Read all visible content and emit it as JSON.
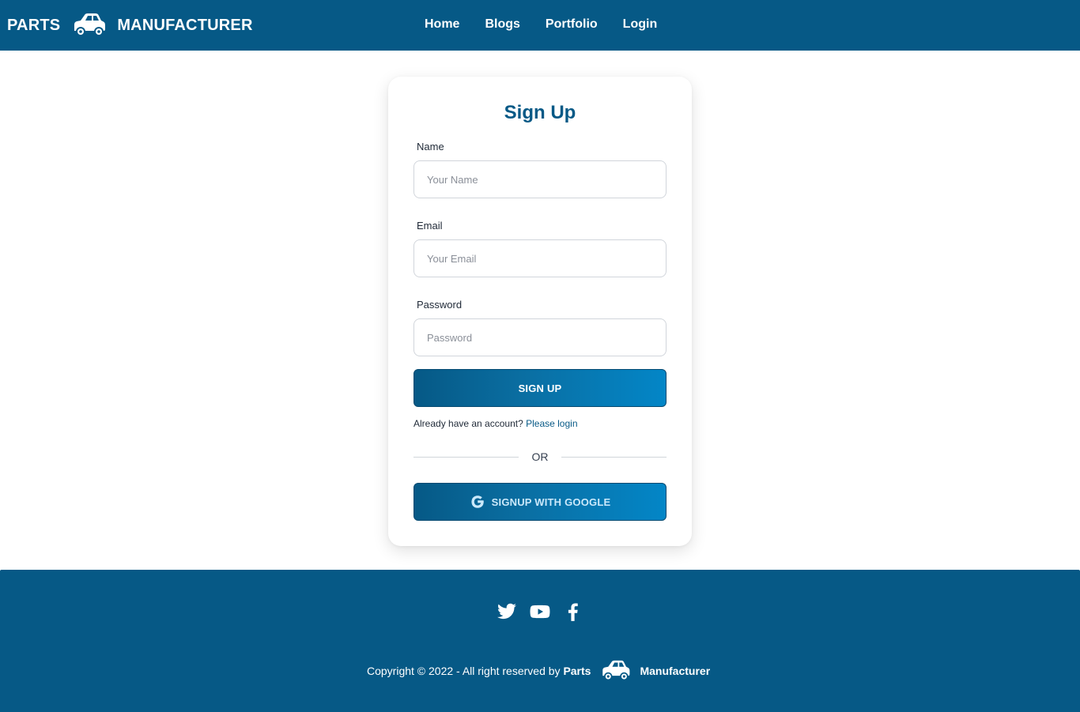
{
  "header": {
    "brand_left": "PARTS",
    "brand_right": "MANUFACTURER",
    "nav": [
      "Home",
      "Blogs",
      "Portfolio",
      "Login"
    ]
  },
  "signup": {
    "title": "Sign Up",
    "name_label": "Name",
    "name_placeholder": "Your Name",
    "email_label": "Email",
    "email_placeholder": "Your Email",
    "password_label": "Password",
    "password_placeholder": "Password",
    "submit_label": "SIGN UP",
    "already_text": "Already have an account?",
    "login_link": "Please login",
    "or_text": "OR",
    "google_label": "SIGNUP WITH GOOGLE"
  },
  "footer": {
    "social_icons": [
      "twitter-icon",
      "youtube-icon",
      "facebook-icon"
    ],
    "copyright": "Copyright © 2022 - All right reserved by",
    "brand_left": "Parts",
    "brand_right": "Manufacturer"
  },
  "colors": {
    "primary": "#065986",
    "accent_light": "#0386c7",
    "white": "#ffffff"
  }
}
